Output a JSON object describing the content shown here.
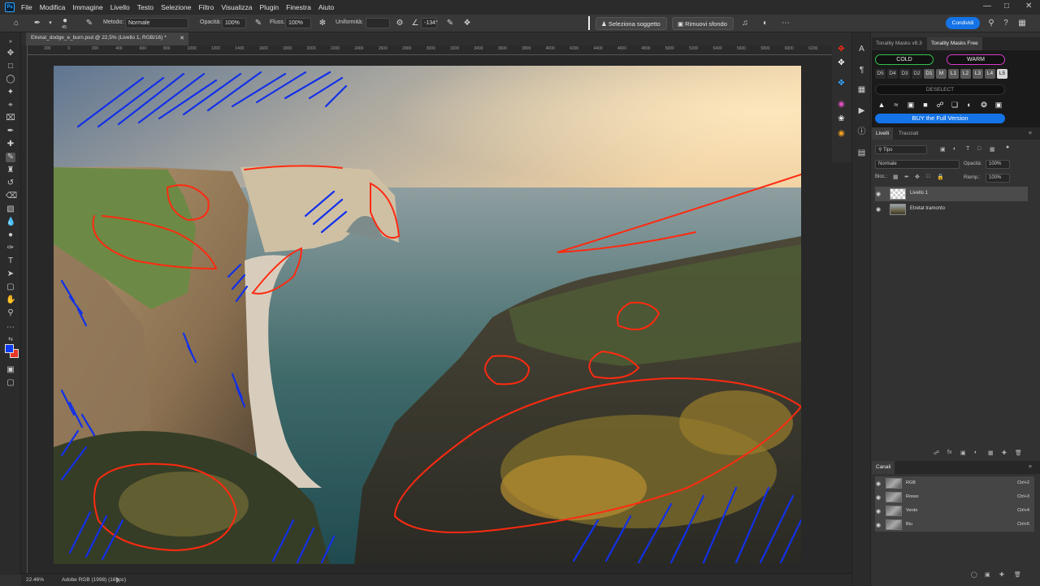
{
  "menu": {
    "items": [
      "File",
      "Modifica",
      "Immagine",
      "Livello",
      "Testo",
      "Selezione",
      "Filtro",
      "Visualizza",
      "Plugin",
      "Finestra",
      "Aiuto"
    ]
  },
  "options": {
    "brush_size": "45",
    "metodo_label": "Metodo:",
    "metodo_value": "Normale",
    "opacita_label": "Opacità:",
    "opacita_value": "100%",
    "flusso_label": "Fluss.:",
    "flusso_value": "100%",
    "uniformita_label": "Uniformità:",
    "angle_value": "-134°",
    "select_subject": "Seleziona soggetto",
    "remove_bg": "Rimuovi sfondo",
    "share": "Condividi"
  },
  "document": {
    "tab_title": "Etretat_dodge_e_burn.psd @ 22,5% (Livello 1, RGB/16) *"
  },
  "ruler": {
    "ticks": [
      "200",
      "0",
      "200",
      "400",
      "600",
      "800",
      "1000",
      "1200",
      "1400",
      "1600",
      "1800",
      "2000",
      "2200",
      "2400",
      "2600",
      "2800",
      "3000",
      "3200",
      "3400",
      "3600",
      "3800",
      "4000",
      "4200",
      "4400",
      "4600",
      "4800",
      "5000",
      "5200",
      "5400",
      "5600",
      "5800",
      "6000",
      "6200",
      "6400"
    ]
  },
  "status": {
    "zoom": "22.46%",
    "profile": "Adobe RGB (1998) (16bpc)"
  },
  "tonality": {
    "tabs": [
      "Tonality Masks v8.3",
      "Tonality Masks Free"
    ],
    "cold": "COLD",
    "warm": "WARM",
    "cold_color": "#35c24a",
    "warm_color": "#d43cc8",
    "keys": [
      "D5",
      "D4",
      "D3",
      "D2",
      "D1",
      "M",
      "L1",
      "L2",
      "L3",
      "L4",
      "L5"
    ],
    "deselect": "DESELECT",
    "buy": "BUY the Full Version"
  },
  "layers": {
    "tabs": [
      "Livelli",
      "Tracciati"
    ],
    "filter": "Tipo",
    "blend": "Normale",
    "opacity_label": "Opacità:",
    "opacity_value": "100%",
    "lock_label": "Bloc.:",
    "fill_label": "Riemp.:",
    "fill_value": "100%",
    "items": [
      {
        "name": "Livello 1"
      },
      {
        "name": "Etretat tramonto"
      }
    ]
  },
  "channels": {
    "title": "Canali",
    "items": [
      {
        "name": "RGB",
        "shortcut": "Ctrl+2"
      },
      {
        "name": "Rosso",
        "shortcut": "Ctrl+3"
      },
      {
        "name": "Verde",
        "shortcut": "Ctrl+4"
      },
      {
        "name": "Blu",
        "shortcut": "Ctrl+5"
      }
    ]
  },
  "colors": {
    "foreground": "#0b3bf0",
    "background": "#ea3323",
    "accent": "#1473e6",
    "dodge_marks": "#ff2a10",
    "burn_marks": "#1230e8"
  }
}
